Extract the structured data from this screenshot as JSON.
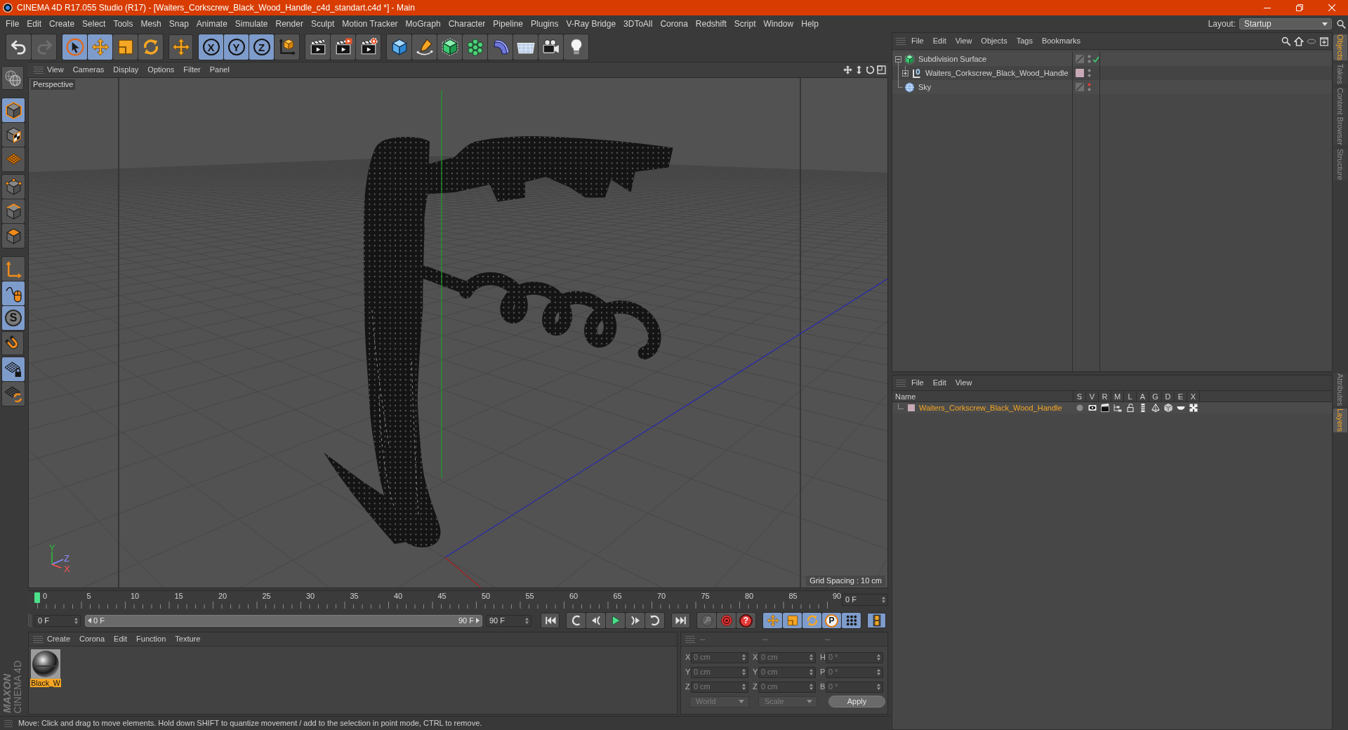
{
  "window": {
    "title": "CINEMA 4D R17.055 Studio (R17) - [Waiters_Corkscrew_Black_Wood_Handle_c4d_standart.c4d *] - Main"
  },
  "menu_bar": [
    "File",
    "Edit",
    "Create",
    "Select",
    "Tools",
    "Mesh",
    "Snap",
    "Animate",
    "Simulate",
    "Render",
    "Sculpt",
    "Motion Tracker",
    "MoGraph",
    "Character",
    "Pipeline",
    "Plugins",
    "V-Ray Bridge",
    "3DToAll",
    "Corona",
    "Redshift",
    "Script",
    "Window",
    "Help"
  ],
  "layout": {
    "label": "Layout:",
    "value": "Startup"
  },
  "toolbar": [
    [
      {
        "kind": "undo",
        "active": false,
        "disabled": false
      },
      {
        "kind": "redo",
        "active": false,
        "disabled": true
      }
    ],
    [
      {
        "kind": "select",
        "active": true,
        "disabled": false
      },
      {
        "kind": "move",
        "active": true,
        "disabled": false
      },
      {
        "kind": "scale",
        "active": false,
        "disabled": false
      },
      {
        "kind": "rotate",
        "active": false,
        "disabled": false
      }
    ],
    [
      {
        "kind": "transform",
        "active": false,
        "disabled": false
      }
    ],
    [
      {
        "kind": "axis-lock",
        "label": "X",
        "active": true,
        "disabled": false
      },
      {
        "kind": "axis-lock",
        "label": "Y",
        "active": true,
        "disabled": false
      },
      {
        "kind": "axis-lock",
        "label": "Z",
        "active": true,
        "disabled": false
      },
      {
        "kind": "coord-system",
        "active": false,
        "disabled": false
      }
    ],
    [
      {
        "kind": "render-view",
        "active": false,
        "disabled": false
      },
      {
        "kind": "render",
        "active": false,
        "disabled": false
      },
      {
        "kind": "render-settings",
        "active": false,
        "disabled": false
      }
    ],
    [
      {
        "kind": "cube",
        "active": false,
        "disabled": false
      },
      {
        "kind": "pen",
        "active": false,
        "disabled": false
      },
      {
        "kind": "subdivision",
        "active": false,
        "disabled": false
      },
      {
        "kind": "cloner",
        "active": false,
        "disabled": false
      },
      {
        "kind": "bend",
        "active": false,
        "disabled": false
      },
      {
        "kind": "floor",
        "active": false,
        "disabled": false
      },
      {
        "kind": "camera",
        "active": false,
        "disabled": false
      },
      {
        "kind": "light",
        "active": false,
        "disabled": false
      }
    ]
  ],
  "mode_toolbar": [
    [
      {
        "kind": "make-editable",
        "active": false,
        "disabled": false
      }
    ],
    [
      {
        "kind": "model",
        "active": true,
        "disabled": false
      },
      {
        "kind": "texture",
        "active": false,
        "disabled": false
      },
      {
        "kind": "workplane",
        "active": false,
        "disabled": false
      }
    ],
    [
      {
        "kind": "points",
        "active": false,
        "disabled": false
      },
      {
        "kind": "edges",
        "active": false,
        "disabled": false
      },
      {
        "kind": "polygons",
        "active": false,
        "disabled": false
      }
    ],
    [
      {
        "kind": "axis",
        "active": false,
        "disabled": false
      },
      {
        "kind": "tweak",
        "active": true,
        "disabled": false
      },
      {
        "kind": "solo",
        "label": "S",
        "active": true,
        "disabled": false
      }
    ],
    [
      {
        "kind": "snap",
        "active": false,
        "disabled": false
      }
    ],
    [
      {
        "kind": "lock-workplane",
        "active": true,
        "disabled": false
      },
      {
        "kind": "workplane-rotate",
        "active": false,
        "disabled": false
      }
    ]
  ],
  "viewport": {
    "menu": [
      "View",
      "Cameras",
      "Display",
      "Options",
      "Filter",
      "Panel"
    ],
    "camera": "Perspective",
    "axis_gizmo": [
      {
        "label": "Y",
        "color": "#2bbf3a"
      },
      {
        "label": "Z",
        "color": "#8c8cff"
      },
      {
        "label": "X",
        "color": "#ff5050"
      }
    ],
    "grid_spacing": "Grid Spacing : 10 cm"
  },
  "timeline": {
    "labels": [
      "0",
      "5",
      "10",
      "15",
      "20",
      "25",
      "30",
      "35",
      "40",
      "45",
      "50",
      "55",
      "60",
      "65",
      "70",
      "75",
      "80",
      "85",
      "90"
    ],
    "playhead": {
      "level": 0
    },
    "current_frame": "0 F"
  },
  "transport": {
    "start_field": "0 F",
    "range": {
      "start": "0 F",
      "end": "90 F",
      "level": 1
    },
    "end_field": "90 F",
    "buttons": [
      [
        {
          "kind": "go-start",
          "active": false,
          "disabled": false
        }
      ],
      [
        {
          "kind": "prev-key",
          "active": false,
          "disabled": false
        },
        {
          "kind": "step-back",
          "active": false,
          "disabled": false
        },
        {
          "kind": "play",
          "active": false,
          "disabled": false
        },
        {
          "kind": "step-forward",
          "active": false,
          "disabled": false
        },
        {
          "kind": "next-key",
          "active": false,
          "disabled": false
        }
      ],
      [
        {
          "kind": "go-end",
          "active": false,
          "disabled": false
        }
      ],
      [
        {
          "kind": "key",
          "active": false,
          "disabled": true
        },
        {
          "kind": "record",
          "active": false,
          "disabled": false
        },
        {
          "kind": "autokey",
          "label": "?",
          "active": false,
          "disabled": false
        }
      ],
      [
        {
          "kind": "move",
          "active": true,
          "disabled": false
        },
        {
          "kind": "scale",
          "active": true,
          "disabled": false
        },
        {
          "kind": "rotate",
          "active": true,
          "disabled": false
        },
        {
          "kind": "param",
          "label": "P",
          "active": true,
          "disabled": false
        },
        {
          "kind": "pla",
          "active": true,
          "disabled": false
        }
      ],
      [
        {
          "kind": "film",
          "active": true,
          "disabled": false
        }
      ]
    ]
  },
  "materials": {
    "menu": [
      "Create",
      "Corona",
      "Edit",
      "Function",
      "Texture"
    ],
    "items": [
      {
        "name": "Black_W",
        "selected": true
      }
    ]
  },
  "coordinates": {
    "disabled": true,
    "headers": [
      "--",
      "--",
      "--"
    ],
    "rows": [
      [
        {
          "label": "X",
          "value": "0 cm"
        },
        {
          "label": "X",
          "value": "0 cm"
        },
        {
          "label": "H",
          "value": "0 °"
        }
      ],
      [
        {
          "label": "Y",
          "value": "0 cm"
        },
        {
          "label": "Y",
          "value": "0 cm"
        },
        {
          "label": "P",
          "value": "0 °"
        }
      ],
      [
        {
          "label": "Z",
          "value": "0 cm"
        },
        {
          "label": "Z",
          "value": "0 cm"
        },
        {
          "label": "B",
          "value": "0 °"
        }
      ]
    ],
    "dropdowns": [
      "World",
      "Scale"
    ],
    "apply": "Apply"
  },
  "status_bar": "Move: Click and drag to move elements. Hold down SHIFT to quantize movement / add to the selection in point mode, CTRL to remove.",
  "logo": [
    "MAXON",
    "CINEMA 4D"
  ],
  "objects_manager": {
    "menu": [
      "File",
      "Edit",
      "View",
      "Objects",
      "Tags",
      "Bookmarks"
    ],
    "objects": [
      {
        "kind": "subdivision",
        "name": "Subdivision Surface",
        "expanded": true,
        "hidden_in_editor": false,
        "check": true,
        "children": [
          {
            "kind": "null",
            "name": "Waiters_Corkscrew_Black_Wood_Handle",
            "expanded": false,
            "color": "#c9a9b7",
            "hidden_in_editor": false,
            "check": false
          }
        ]
      },
      {
        "kind": "sky",
        "name": "Sky",
        "hidden_in_editor": true,
        "check": false
      }
    ]
  },
  "layers_manager": {
    "menu": [
      "File",
      "Edit",
      "View"
    ],
    "columns": [
      "Name",
      "S",
      "V",
      "R",
      "M",
      "L",
      "A",
      "G",
      "D",
      "E",
      "X"
    ],
    "layers": [
      {
        "name": "Waiters_Corkscrew_Black_Wood_Handle",
        "color": "#c9a9b7",
        "selected": true
      }
    ]
  },
  "side_tabs": [
    [
      {
        "label": "Objects",
        "selected": true
      },
      {
        "label": "Takes",
        "selected": false
      },
      {
        "label": "Content Browser",
        "selected": false
      },
      {
        "label": "Structure",
        "selected": false
      }
    ],
    [
      {
        "label": "Attributes",
        "selected": false
      },
      {
        "label": "Layers",
        "selected": true
      }
    ]
  ]
}
